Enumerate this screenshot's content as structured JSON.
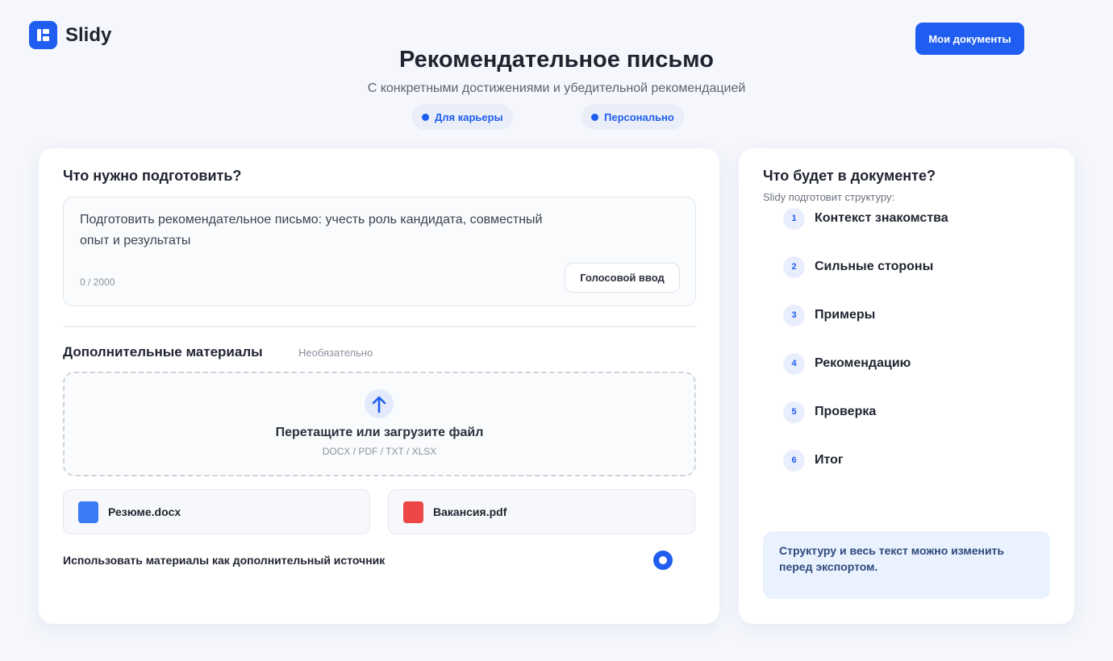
{
  "app": {
    "name": "Slidy"
  },
  "header": {
    "my_docs_label": "Мои документы"
  },
  "page": {
    "title": "Рекомендательное письмо",
    "subtitle": "С конкретными достижениями и убедительной рекомендацией",
    "chips": [
      "Для карьеры",
      "Персонально"
    ]
  },
  "prepare": {
    "heading": "Что нужно подготовить?",
    "text": "Подготовить рекомендательное письмо: учесть роль кандидата, совместный опыт и результаты",
    "counter": "0 / 2000",
    "voice_label": "Голосовой ввод"
  },
  "materials": {
    "heading": "Дополнительные материалы",
    "optional": "Необязательно",
    "drop_title": "Перетащите или загрузите файл",
    "drop_formats": "DOCX / PDF / TXT / XLSX",
    "files": [
      {
        "name": "Резюме.docx",
        "color": "#3b7bf5"
      },
      {
        "name": "Вакансия.pdf",
        "color": "#ee4747"
      }
    ],
    "use_label": "Использовать материалы как дополнительный источник",
    "use_enabled": true
  },
  "outline": {
    "heading": "Что будет в документе?",
    "subtitle": "Slidy подготовит структуру:",
    "steps": [
      {
        "num": "1",
        "label": "Контекст знакомства"
      },
      {
        "num": "2",
        "label": "Сильные стороны"
      },
      {
        "num": "3",
        "label": "Примеры"
      },
      {
        "num": "4",
        "label": "Рекомендацию"
      },
      {
        "num": "5",
        "label": "Проверка"
      },
      {
        "num": "6",
        "label": "Итог"
      }
    ],
    "note": "Структуру и весь текст можно изменить перед экспортом."
  },
  "colors": {
    "accent": "#1f5ef0",
    "background": "#f5f7fc"
  }
}
